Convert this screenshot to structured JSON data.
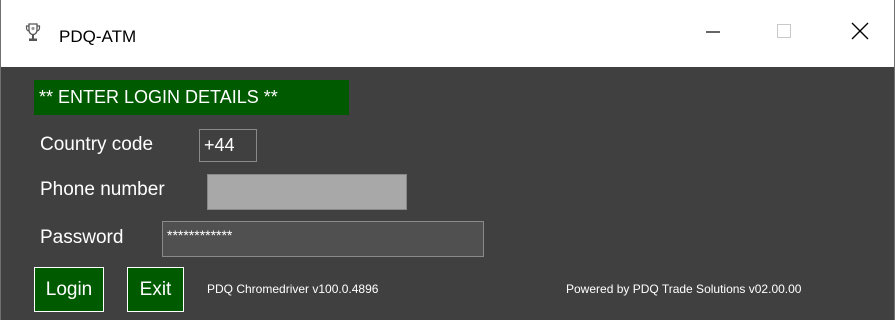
{
  "window": {
    "title": "PDQ-ATM",
    "icons": {
      "app": "trophy-icon",
      "minimize": "minimize-icon",
      "maximize": "maximize-icon",
      "close": "close-icon"
    }
  },
  "banner": {
    "text": "** ENTER LOGIN DETAILS **"
  },
  "form": {
    "country_code_label": "Country code",
    "country_code_value": "+44",
    "phone_label": "Phone number",
    "phone_value": "",
    "password_label": "Password",
    "password_value": "************"
  },
  "buttons": {
    "login": "Login",
    "exit": "Exit"
  },
  "footer": {
    "driver_version": "PDQ Chromedriver v100.0.4896",
    "powered_by": "Powered by PDQ Trade Solutions v02.00.00"
  },
  "colors": {
    "background": "#404040",
    "accent_green": "#005a00",
    "phone_field": "#a8a8a8"
  }
}
